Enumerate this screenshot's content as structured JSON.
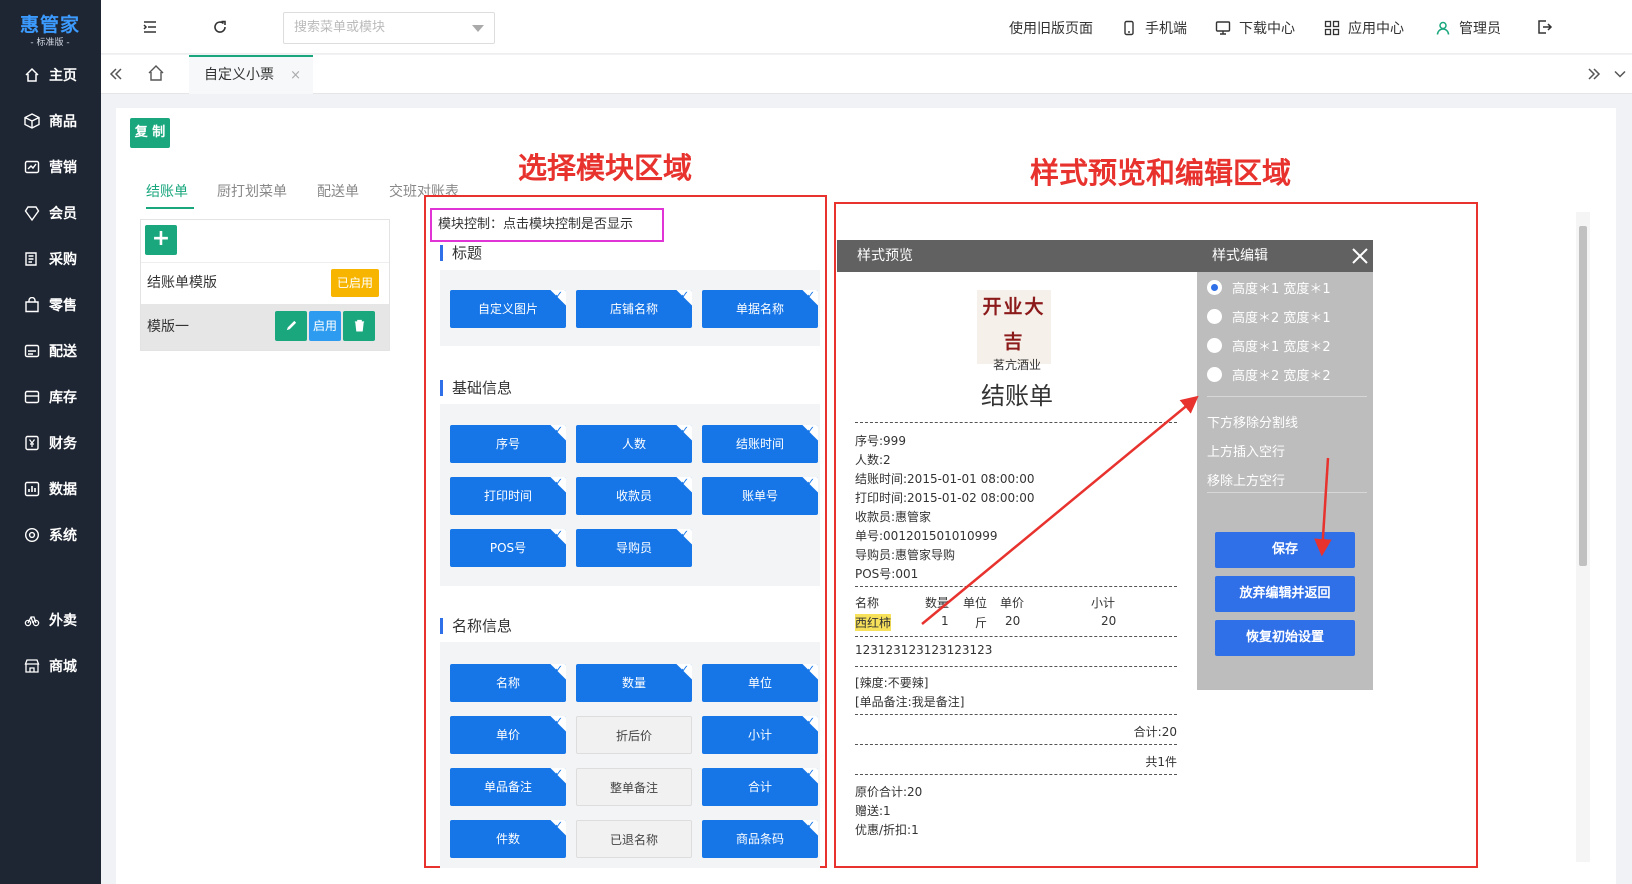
{
  "brand": {
    "name": "惠管家",
    "edition": "- 标准版 -"
  },
  "sidebar": {
    "items": [
      {
        "label": "主页",
        "icon": "home-icon"
      },
      {
        "label": "商品",
        "icon": "box-icon"
      },
      {
        "label": "营销",
        "icon": "chart-icon"
      },
      {
        "label": "会员",
        "icon": "diamond-icon"
      },
      {
        "label": "采购",
        "icon": "list-icon"
      },
      {
        "label": "零售",
        "icon": "bag-icon"
      },
      {
        "label": "配送",
        "icon": "truck-icon"
      },
      {
        "label": "库存",
        "icon": "storage-icon"
      },
      {
        "label": "财务",
        "icon": "yen-icon"
      },
      {
        "label": "数据",
        "icon": "bar-chart-icon"
      },
      {
        "label": "系统",
        "icon": "gear-icon"
      },
      {
        "label": "外卖",
        "icon": "bike-icon"
      },
      {
        "label": "商城",
        "icon": "store-icon"
      }
    ]
  },
  "topbar": {
    "search_placeholder": "搜索菜单或模块",
    "old_page": "使用旧版页面",
    "mobile": "手机端",
    "download": "下载中心",
    "apps": "应用中心",
    "user": "管理员"
  },
  "tabs": {
    "active": "自定义小票",
    "close": "×"
  },
  "left": {
    "copy_label": "复 制",
    "receipt_tabs": [
      "结账单",
      "厨打划菜单",
      "配送单",
      "交班对账表"
    ],
    "add_label": "+",
    "templates": [
      {
        "name": "结账单模版",
        "badge": "已启用"
      },
      {
        "name": "模版一",
        "enable": "启用"
      }
    ]
  },
  "annotations": {
    "select_area": "选择模块区域",
    "preview_area": "样式预览和编辑区域"
  },
  "modules": {
    "hint": "模块控制：点击模块控制是否显示",
    "sections": [
      {
        "title": "标题",
        "buttons": [
          {
            "label": "自定义图片",
            "on": true
          },
          {
            "label": "店铺名称",
            "on": true
          },
          {
            "label": "单据名称",
            "on": true
          }
        ]
      },
      {
        "title": "基础信息",
        "buttons": [
          {
            "label": "序号",
            "on": true
          },
          {
            "label": "人数",
            "on": true
          },
          {
            "label": "结账时间",
            "on": true
          },
          {
            "label": "打印时间",
            "on": true
          },
          {
            "label": "收款员",
            "on": true
          },
          {
            "label": "账单号",
            "on": true
          },
          {
            "label": "POS号",
            "on": true
          },
          {
            "label": "导购员",
            "on": true
          }
        ]
      },
      {
        "title": "名称信息",
        "buttons": [
          {
            "label": "名称",
            "on": true
          },
          {
            "label": "数量",
            "on": true
          },
          {
            "label": "单位",
            "on": true
          },
          {
            "label": "单价",
            "on": true
          },
          {
            "label": "折后价",
            "on": false
          },
          {
            "label": "小计",
            "on": true
          },
          {
            "label": "单品备注",
            "on": true
          },
          {
            "label": "整单备注",
            "on": false
          },
          {
            "label": "合计",
            "on": true
          },
          {
            "label": "件数",
            "on": true
          },
          {
            "label": "已退名称",
            "on": false
          },
          {
            "label": "商品条码",
            "on": true
          }
        ]
      }
    ]
  },
  "preview": {
    "title": "样式预览",
    "edit_title": "样式编辑",
    "logo_text": "开业大吉",
    "shop": "茗亢酒业",
    "doc_title": "结账单",
    "basic": [
      "序号:999",
      "人数:2",
      "结账时间:2015-01-01 08:00:00",
      "打印时间:2015-01-02 08:00:00",
      "收款员:惠管家",
      "单号:001201501010999",
      "导购员:惠管家导购",
      "POS号:001"
    ],
    "table_head": [
      "名称",
      "数量",
      "单位",
      "单价",
      "小计"
    ],
    "item": {
      "name": "西红柿",
      "qty": "1",
      "unit": "斤",
      "price": "20",
      "subtotal": "20"
    },
    "barcode": "123123123123123123",
    "remarks": [
      "[辣度:不要辣]",
      "[单品备注:我是备注]"
    ],
    "total": "合计:20",
    "count": "共1件",
    "footer": [
      "原价合计:20",
      "赠送:1",
      "优惠/折扣:1"
    ]
  },
  "edit": {
    "options": [
      "高度＊1 宽度＊1",
      "高度＊2 宽度＊1",
      "高度＊1 宽度＊2",
      "高度＊2 宽度＊2"
    ],
    "selected": 0,
    "links": [
      "下方移除分割线",
      "上方插入空行",
      "移除上方空行"
    ],
    "save": "保存",
    "discard": "放弃编辑并返回",
    "reset": "恢复初始设置"
  },
  "colors": {
    "accent": "#1aa77e",
    "blue": "#1676e8",
    "annotation": "#e8322e",
    "sidebar": "#1f2633"
  }
}
